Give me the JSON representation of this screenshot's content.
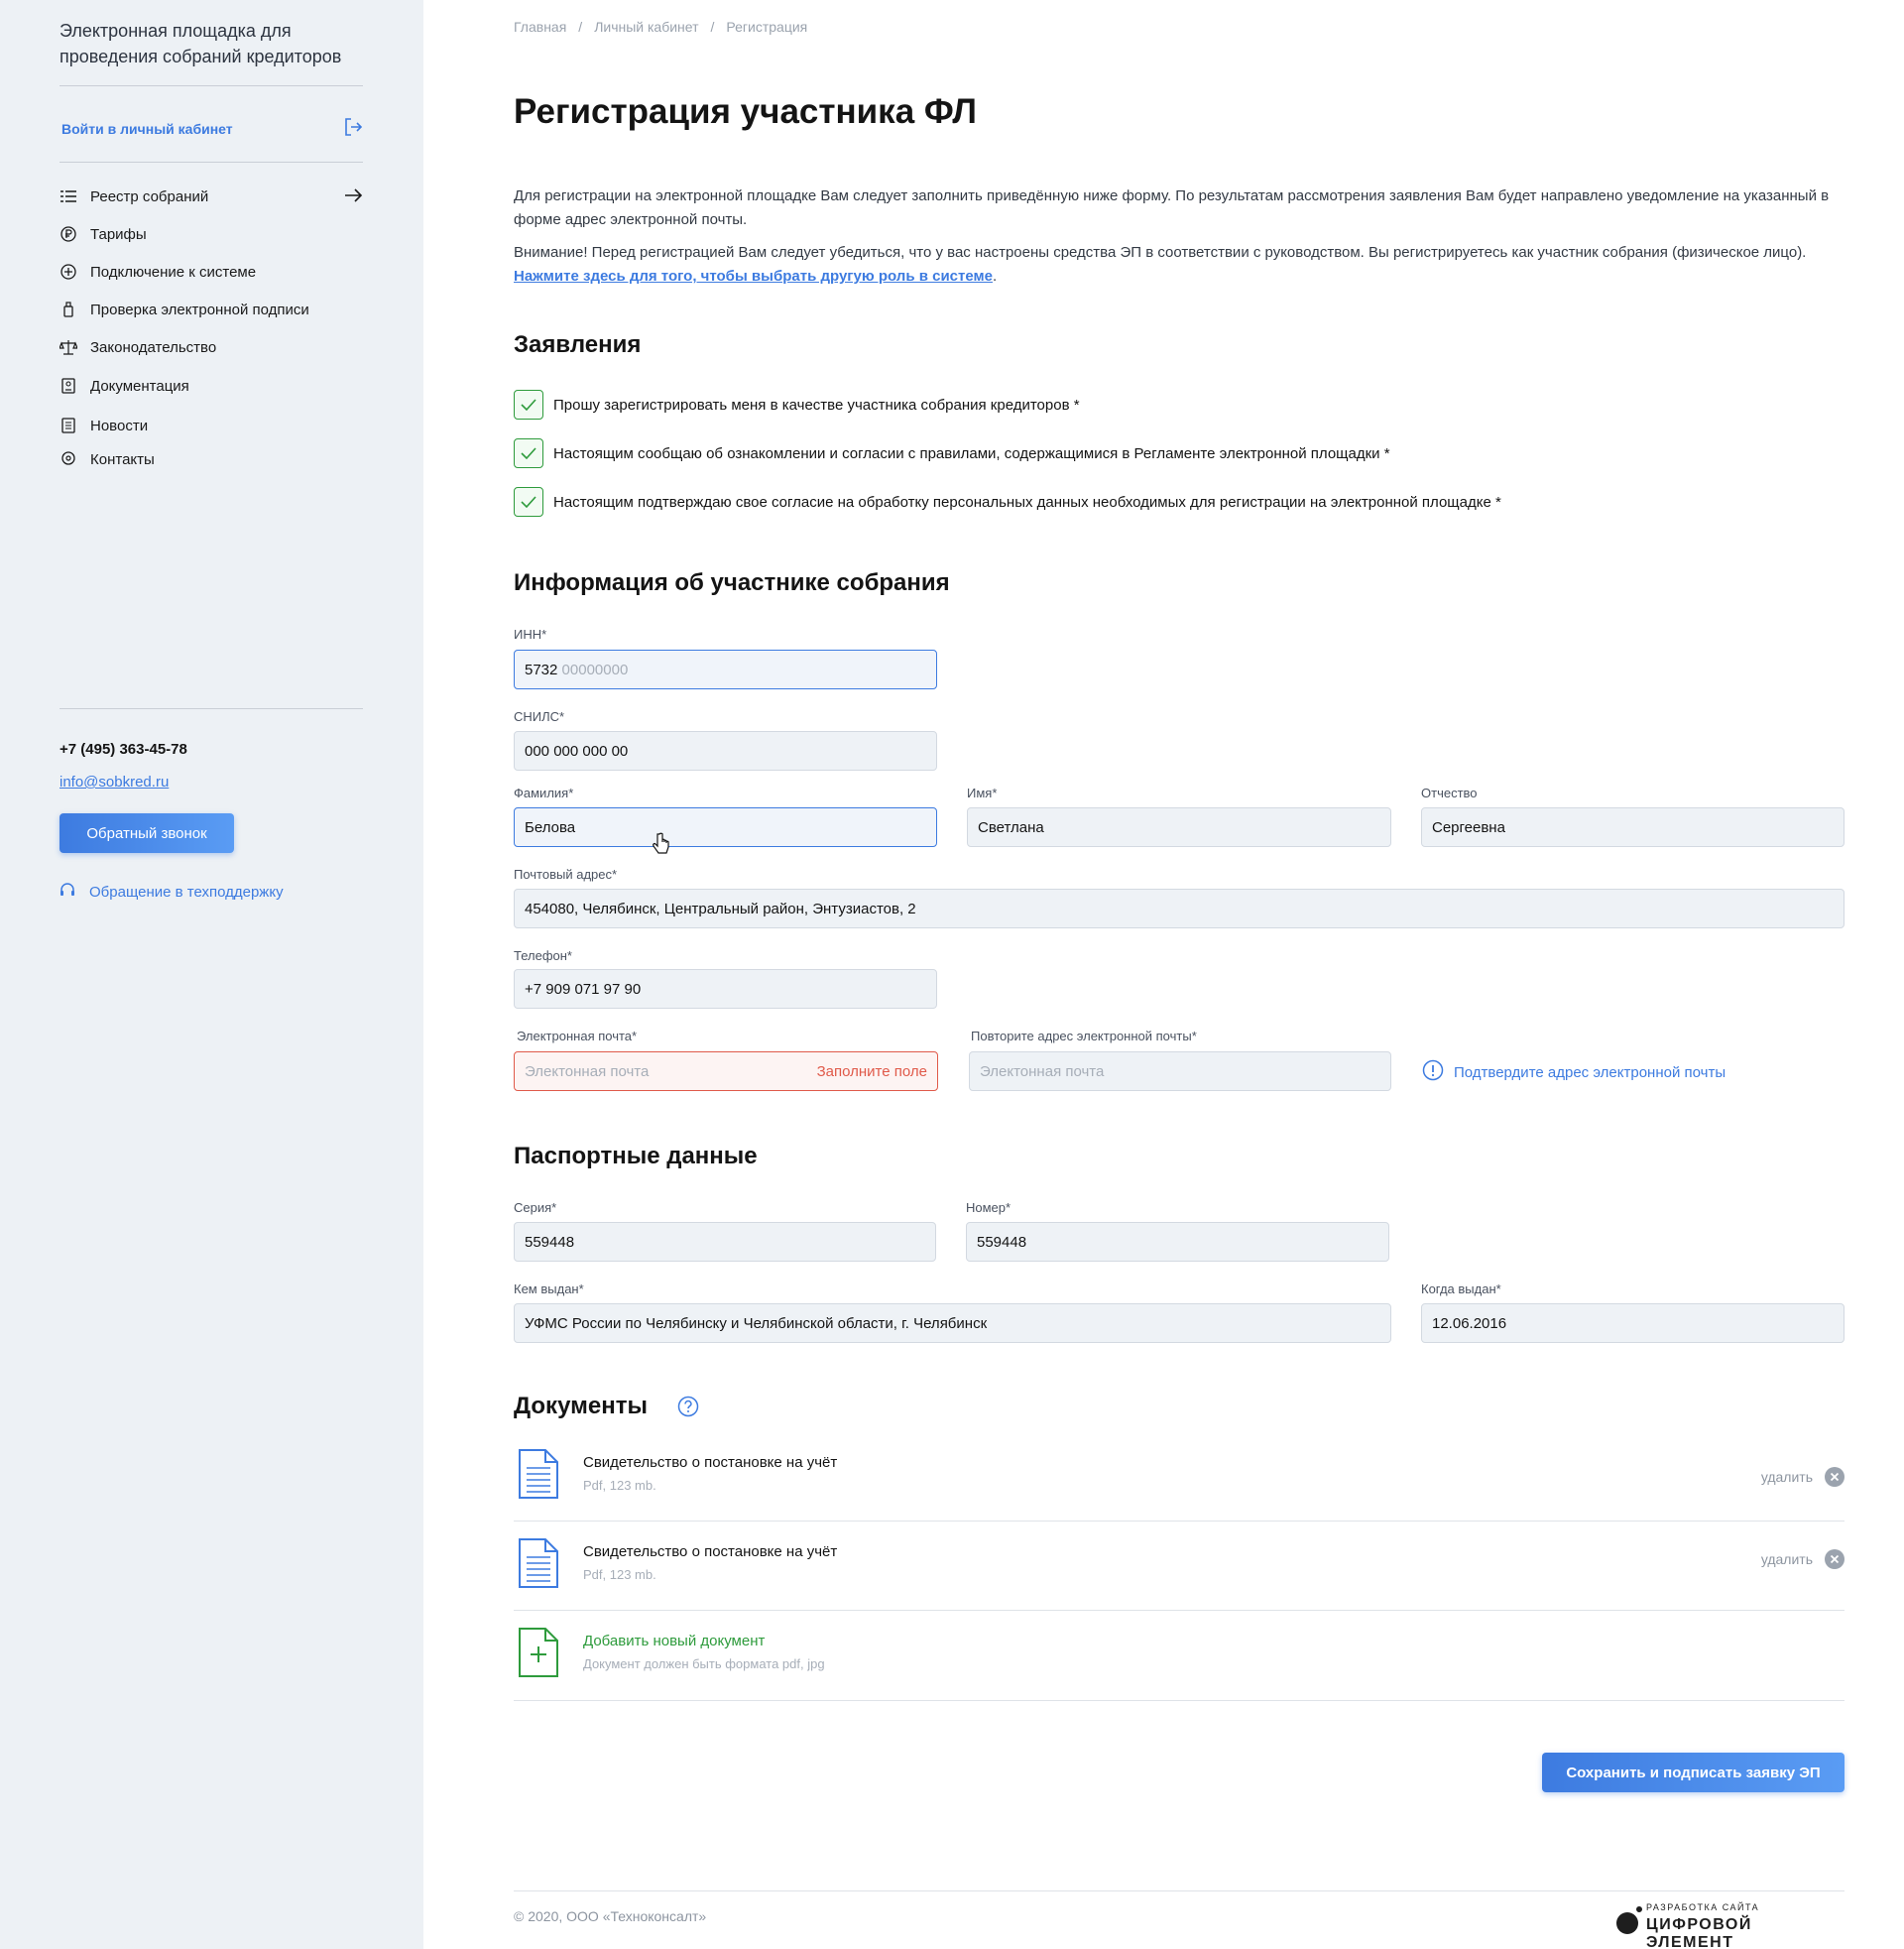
{
  "sidebar": {
    "title": "Электронная площадка для проведения собраний кредиторов",
    "login_label": "Войти в личный кабинет",
    "nav": [
      {
        "label": "Реестр собраний",
        "icon": "list-icon"
      },
      {
        "label": "Тарифы",
        "icon": "ruble-icon"
      },
      {
        "label": "Подключение к системе",
        "icon": "plus-circle-icon"
      },
      {
        "label": "Проверка электронной подписи",
        "icon": "usb-token-icon"
      },
      {
        "label": "Законодательство",
        "icon": "scales-icon"
      },
      {
        "label": "Документация",
        "icon": "document-badge-icon"
      },
      {
        "label": "Новости",
        "icon": "news-icon"
      },
      {
        "label": "Контакты",
        "icon": "location-pin-icon"
      }
    ],
    "phone": "+7 (495) 363-45-78",
    "email": "info@sobkred.ru",
    "callback_label": "Обратный звонок",
    "support_label": "Обращение в техподдержку"
  },
  "breadcrumbs": [
    "Главная",
    "Личный кабинет",
    "Регистрация"
  ],
  "page_title": "Регистрация участника ФЛ",
  "intro": {
    "p1": "Для регистрации на электронной площадке Вам следует заполнить приведённую ниже форму. По результатам рассмотрения заявления Вам будет направлено уведомление на указанный в форме адрес электронной почты.",
    "p2": "Внимание! Перед регистрацией Вам следует убедиться, что у вас настроены средства ЭП в соответствии с руководством. Вы регистрируетесь как участник собрания (физическое лицо).",
    "p2_link": "Нажмите здесь для того, чтобы выбрать другую роль в системе",
    "p2_end": "."
  },
  "statements": {
    "title": "Заявления",
    "items": [
      {
        "label": "Прошу зарегистрировать меня в качестве участника собрания кредиторов *",
        "checked": true
      },
      {
        "label": "Настоящим сообщаю об ознакомлении и согласии с правилами, содержащимися в Регламенте электронной площадки *",
        "checked": true
      },
      {
        "label": "Настоящим подтверждаю свое согласие на обработку персональных данных необходимых для регистрации на электронной площадке *",
        "checked": true
      }
    ]
  },
  "participant": {
    "title": "Информация об участнике собрания",
    "inn": {
      "label": "ИНН*",
      "value": "5732",
      "mask": "00000000"
    },
    "snils": {
      "label": "СНИЛС*",
      "value": "000 000 000 00"
    },
    "surname": {
      "label": "Фамилия*",
      "value": "Белова"
    },
    "name": {
      "label": "Имя*",
      "value": "Светлана"
    },
    "patronymic": {
      "label": "Отчество",
      "value": "Сергеевна"
    },
    "address": {
      "label": "Почтовый адрес*",
      "value": "454080, Челябинск, Центральный район, Энтузиастов, 2"
    },
    "phone": {
      "label": "Телефон*",
      "value": "+7 909 071 97 90"
    },
    "email": {
      "label": "Электронная почта*",
      "placeholder": "Элeктонная почта",
      "error": "Заполните поле"
    },
    "email_repeat": {
      "label": "Повторите адрес электронной почты*",
      "placeholder": "Элeктонная почта"
    },
    "confirm_email": "Подтвердите адрес электронной почты"
  },
  "passport": {
    "title": "Паспортные данные",
    "series": {
      "label": "Серия*",
      "value": "559448"
    },
    "number": {
      "label": "Номер*",
      "value": "559448"
    },
    "issued_by": {
      "label": "Кем выдан*",
      "value": "УФМС России по Челябинску и Челябинской области, г. Челябинск"
    },
    "issued_date": {
      "label": "Когда выдан*",
      "value": "12.06.2016"
    }
  },
  "documents": {
    "title": "Документы",
    "items": [
      {
        "name": "Свидетельство о постановке на учёт",
        "meta": "Pdf, 123 mb.",
        "delete": "удалить"
      },
      {
        "name": "Свидетельство о постановке на учёт",
        "meta": "Pdf, 123 mb.",
        "delete": "удалить"
      }
    ],
    "add_label": "Добавить новый документ",
    "add_hint": "Документ должен быть формата pdf, jpg"
  },
  "submit_label": "Сохранить и подписать заявку ЭП",
  "footer": {
    "copyright": "© 2020, ООО «Техноконсалт»",
    "dev_small": "РАЗРАБОТКА САЙТА",
    "dev_big": "ЦИФРОВОЙ ЭЛЕМЕНТ"
  },
  "colors": {
    "accent": "#3d7be0",
    "success": "#2e9b3c",
    "error": "#e05a4a",
    "sidebar_bg": "#edf1f5"
  }
}
